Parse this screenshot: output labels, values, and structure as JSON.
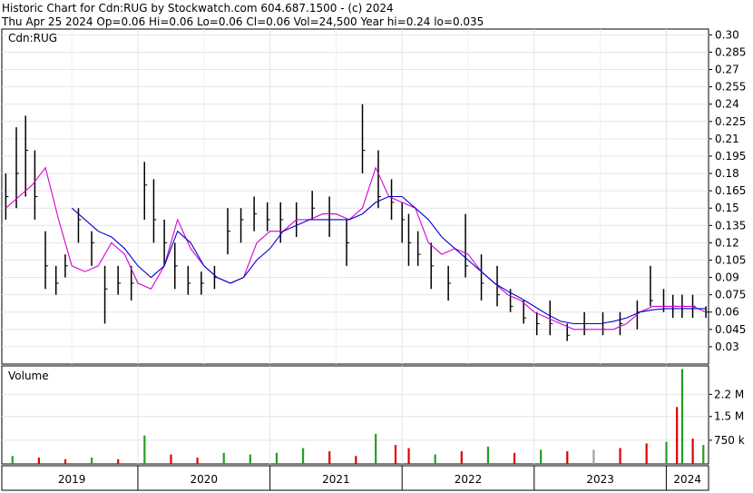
{
  "header": {
    "line1": "Historic Chart for Cdn:RUG by Stockwatch.com 604.687.1500 - (c) 2024",
    "line2": "Thu Apr 25 2024  Op=0.06  Hi=0.06  Lo=0.06  Cl=0.06  Vol=24,500  Year hi=0.24  lo=0.035"
  },
  "colors": {
    "price": "#000000",
    "ma_short": "#d400d4",
    "ma_long": "#0000c8",
    "grid": "#e4e4e4",
    "volume_up": "#22a022",
    "volume_down": "#e00000",
    "volume_flat": "#a0a0a0"
  },
  "chart_data": [
    {
      "type": "line",
      "panel_label": "Cdn:RUG",
      "ylim": [
        0.015,
        0.305
      ],
      "y_ticks": [
        0.3,
        0.285,
        0.27,
        0.255,
        0.24,
        0.225,
        0.21,
        0.195,
        0.18,
        0.165,
        0.15,
        0.135,
        0.12,
        0.105,
        0.09,
        0.075,
        0.06,
        0.045,
        0.03
      ],
      "y_tick_labels": [
        "0.30",
        "0.285",
        "0.27",
        "0.255",
        "0.24",
        "0.225",
        "0.21",
        "0.195",
        "0.18",
        "0.165",
        "0.15",
        "0.135",
        "0.12",
        "0.105",
        "0.09",
        "0.075",
        "0.06",
        "0.045",
        "0.03"
      ],
      "xlim": [
        2018.97,
        2024.32
      ],
      "x_labels": [
        {
          "x": 2019.5,
          "label": "2019"
        },
        {
          "x": 2020.5,
          "label": "2020"
        },
        {
          "x": 2021.5,
          "label": "2021"
        },
        {
          "x": 2022.5,
          "label": "2022"
        },
        {
          "x": 2023.5,
          "label": "2023"
        },
        {
          "x": 2024.16,
          "label": "2024"
        }
      ],
      "year_boundaries": [
        2020,
        2021,
        2022,
        2023,
        2024
      ],
      "grid": true,
      "series": [
        {
          "style": "price-bars",
          "x": [
            2019.0,
            2019.08,
            2019.15,
            2019.22,
            2019.3,
            2019.38,
            2019.45,
            2019.55,
            2019.65,
            2019.75,
            2019.85,
            2019.95,
            2020.05,
            2020.12,
            2020.2,
            2020.28,
            2020.38,
            2020.48,
            2020.58,
            2020.68,
            2020.78,
            2020.88,
            2020.98,
            2021.08,
            2021.2,
            2021.32,
            2021.45,
            2021.58,
            2021.7,
            2021.82,
            2021.92,
            2022.0,
            2022.05,
            2022.12,
            2022.22,
            2022.35,
            2022.48,
            2022.6,
            2022.72,
            2022.82,
            2022.92,
            2023.02,
            2023.12,
            2023.25,
            2023.38,
            2023.52,
            2023.65,
            2023.78,
            2023.88,
            2023.98,
            2024.05,
            2024.12,
            2024.2,
            2024.3
          ],
          "low": [
            0.14,
            0.15,
            0.16,
            0.14,
            0.08,
            0.075,
            0.09,
            0.12,
            0.1,
            0.05,
            0.075,
            0.07,
            0.14,
            0.12,
            0.1,
            0.08,
            0.075,
            0.075,
            0.08,
            0.11,
            0.12,
            0.13,
            0.13,
            0.12,
            0.125,
            0.14,
            0.125,
            0.1,
            0.18,
            0.15,
            0.14,
            0.12,
            0.1,
            0.1,
            0.08,
            0.07,
            0.09,
            0.07,
            0.065,
            0.06,
            0.05,
            0.04,
            0.04,
            0.035,
            0.04,
            0.04,
            0.04,
            0.045,
            0.065,
            0.06,
            0.055,
            0.055,
            0.055,
            0.055
          ],
          "high": [
            0.18,
            0.22,
            0.23,
            0.2,
            0.13,
            0.1,
            0.11,
            0.15,
            0.13,
            0.1,
            0.1,
            0.1,
            0.19,
            0.175,
            0.14,
            0.12,
            0.1,
            0.095,
            0.1,
            0.15,
            0.15,
            0.16,
            0.155,
            0.155,
            0.155,
            0.165,
            0.16,
            0.14,
            0.24,
            0.2,
            0.175,
            0.155,
            0.145,
            0.13,
            0.12,
            0.1,
            0.145,
            0.11,
            0.1,
            0.08,
            0.07,
            0.06,
            0.07,
            0.05,
            0.06,
            0.06,
            0.06,
            0.07,
            0.1,
            0.08,
            0.075,
            0.075,
            0.075,
            0.065
          ],
          "close": [
            0.16,
            0.18,
            0.2,
            0.16,
            0.1,
            0.085,
            0.1,
            0.14,
            0.12,
            0.08,
            0.085,
            0.085,
            0.17,
            0.14,
            0.12,
            0.1,
            0.085,
            0.085,
            0.09,
            0.13,
            0.14,
            0.145,
            0.14,
            0.14,
            0.14,
            0.15,
            0.14,
            0.12,
            0.2,
            0.16,
            0.155,
            0.14,
            0.12,
            0.11,
            0.1,
            0.085,
            0.1,
            0.085,
            0.075,
            0.065,
            0.055,
            0.05,
            0.05,
            0.04,
            0.045,
            0.045,
            0.05,
            0.06,
            0.07,
            0.065,
            0.065,
            0.065,
            0.065,
            0.06
          ]
        },
        {
          "style": "ma-short",
          "x": [
            2019.0,
            2019.1,
            2019.2,
            2019.3,
            2019.4,
            2019.5,
            2019.6,
            2019.7,
            2019.8,
            2019.9,
            2020.0,
            2020.1,
            2020.2,
            2020.3,
            2020.4,
            2020.5,
            2020.6,
            2020.7,
            2020.8,
            2020.9,
            2021.0,
            2021.1,
            2021.2,
            2021.3,
            2021.4,
            2021.5,
            2021.6,
            2021.7,
            2021.8,
            2021.9,
            2022.0,
            2022.1,
            2022.2,
            2022.3,
            2022.4,
            2022.5,
            2022.6,
            2022.7,
            2022.8,
            2022.9,
            2023.0,
            2023.1,
            2023.2,
            2023.3,
            2023.4,
            2023.5,
            2023.6,
            2023.7,
            2023.8,
            2023.9,
            2024.0,
            2024.1,
            2024.2,
            2024.3
          ],
          "values": [
            0.15,
            0.16,
            0.17,
            0.185,
            0.14,
            0.1,
            0.095,
            0.1,
            0.12,
            0.11,
            0.085,
            0.08,
            0.1,
            0.14,
            0.115,
            0.1,
            0.09,
            0.085,
            0.09,
            0.12,
            0.13,
            0.13,
            0.14,
            0.14,
            0.145,
            0.145,
            0.14,
            0.15,
            0.185,
            0.16,
            0.155,
            0.15,
            0.12,
            0.11,
            0.115,
            0.11,
            0.095,
            0.085,
            0.075,
            0.07,
            0.06,
            0.055,
            0.05,
            0.045,
            0.045,
            0.045,
            0.045,
            0.05,
            0.06,
            0.065,
            0.065,
            0.065,
            0.065,
            0.06
          ]
        },
        {
          "style": "ma-long",
          "x": [
            2019.5,
            2019.6,
            2019.7,
            2019.8,
            2019.9,
            2020.0,
            2020.1,
            2020.2,
            2020.3,
            2020.4,
            2020.5,
            2020.6,
            2020.7,
            2020.8,
            2020.9,
            2021.0,
            2021.1,
            2021.2,
            2021.3,
            2021.4,
            2021.5,
            2021.6,
            2021.7,
            2021.8,
            2021.9,
            2022.0,
            2022.1,
            2022.2,
            2022.3,
            2022.4,
            2022.5,
            2022.6,
            2022.7,
            2022.8,
            2022.9,
            2023.0,
            2023.1,
            2023.2,
            2023.3,
            2023.4,
            2023.5,
            2023.6,
            2023.7,
            2023.8,
            2023.9,
            2024.0,
            2024.1,
            2024.2,
            2024.3
          ],
          "values": [
            0.15,
            0.14,
            0.13,
            0.125,
            0.115,
            0.1,
            0.09,
            0.1,
            0.13,
            0.12,
            0.1,
            0.09,
            0.085,
            0.09,
            0.105,
            0.115,
            0.13,
            0.135,
            0.14,
            0.14,
            0.14,
            0.14,
            0.145,
            0.155,
            0.16,
            0.16,
            0.15,
            0.14,
            0.125,
            0.115,
            0.105,
            0.095,
            0.085,
            0.078,
            0.072,
            0.065,
            0.058,
            0.052,
            0.05,
            0.05,
            0.05,
            0.052,
            0.055,
            0.06,
            0.062,
            0.063,
            0.063,
            0.063,
            0.063
          ]
        }
      ]
    },
    {
      "type": "bar",
      "panel_label": "Volume",
      "ylim": [
        0,
        3100000
      ],
      "y_ticks": [
        2200000,
        1500000,
        750000
      ],
      "y_tick_labels": [
        "2.2 M",
        "1.5 M",
        "750 k"
      ],
      "x": [
        2019.05,
        2019.25,
        2019.45,
        2019.65,
        2019.85,
        2020.05,
        2020.25,
        2020.45,
        2020.65,
        2020.85,
        2021.05,
        2021.25,
        2021.45,
        2021.65,
        2021.8,
        2021.95,
        2022.05,
        2022.25,
        2022.45,
        2022.65,
        2022.85,
        2023.05,
        2023.25,
        2023.45,
        2023.65,
        2023.85,
        2024.0,
        2024.08,
        2024.12,
        2024.2,
        2024.28
      ],
      "values": [
        250000,
        200000,
        150000,
        200000,
        150000,
        900000,
        300000,
        200000,
        350000,
        300000,
        350000,
        500000,
        400000,
        250000,
        950000,
        600000,
        500000,
        300000,
        400000,
        550000,
        350000,
        450000,
        400000,
        450000,
        500000,
        650000,
        700000,
        1800000,
        3000000,
        800000,
        600000
      ],
      "colors": [
        "#22a022",
        "#e00000",
        "#e00000",
        "#22a022",
        "#e00000",
        "#22a022",
        "#e00000",
        "#e00000",
        "#22a022",
        "#22a022",
        "#22a022",
        "#22a022",
        "#e00000",
        "#e00000",
        "#22a022",
        "#e00000",
        "#e00000",
        "#22a022",
        "#e00000",
        "#22a022",
        "#e00000",
        "#22a022",
        "#e00000",
        "#a0a0a0",
        "#e00000",
        "#e00000",
        "#22a022",
        "#e00000",
        "#22a022",
        "#e00000",
        "#22a022"
      ]
    }
  ]
}
